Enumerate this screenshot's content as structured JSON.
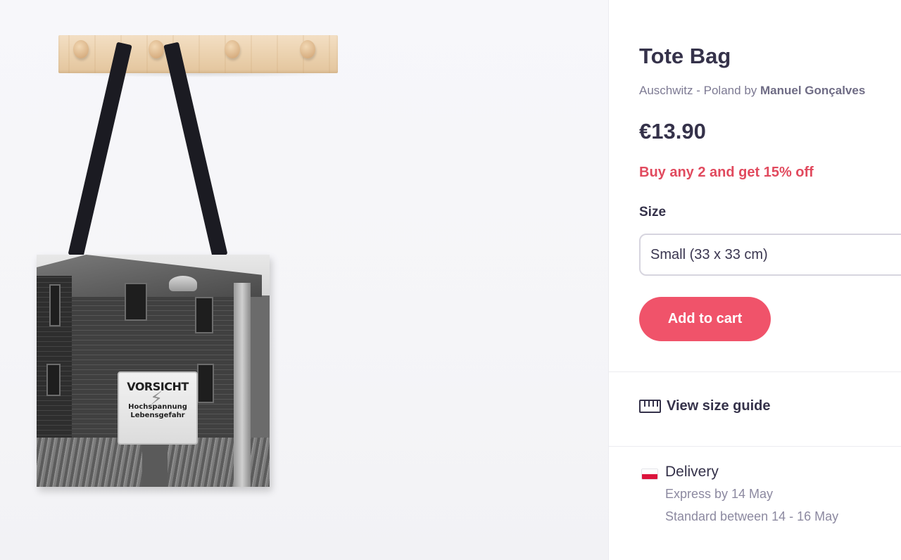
{
  "product": {
    "title": "Tote Bag",
    "design_title": "Auschwitz - Poland",
    "by_word": "by",
    "artist": "Manuel Gonçalves",
    "price": "€13.90",
    "promo": "Buy any 2 and get 15% off"
  },
  "size": {
    "label": "Size",
    "selected": "Small (33 x 33 cm)"
  },
  "cart": {
    "add_label": "Add to cart"
  },
  "size_guide": {
    "label": "View size guide",
    "icon": "ruler-icon"
  },
  "delivery": {
    "heading": "Delivery",
    "flag": "poland-flag-icon",
    "express": "Express by 14 May",
    "standard": "Standard between 14 - 16 May"
  },
  "image": {
    "sign_line1": "VORSICHT",
    "sign_line2": "Hochspannung",
    "sign_line3": "Lebensgefahr"
  },
  "colors": {
    "accent": "#f0536a",
    "promo": "#e14a5e",
    "text": "#35324a"
  }
}
